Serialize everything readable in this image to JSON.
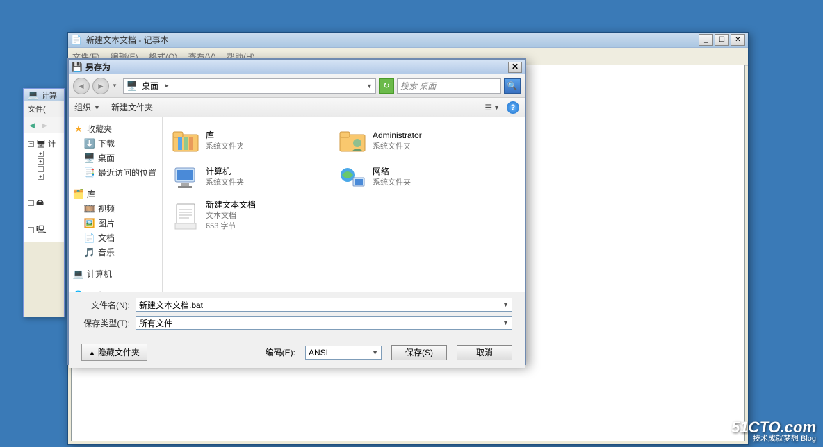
{
  "bgwin": {
    "title": "计算",
    "menu": "文件(",
    "tree": {
      "root": "计",
      "items": [
        "",
        "",
        "",
        ""
      ]
    }
  },
  "notepad": {
    "title": "新建文本文档 - 记事本",
    "menu": {
      "file": "文件(F)",
      "edit": "编辑(E)",
      "format": "格式(O)",
      "view": "查看(V)",
      "help": "帮助(H)"
    }
  },
  "saveas": {
    "title": "另存为",
    "path": "桌面",
    "search_placeholder": "搜索 桌面",
    "toolbar": {
      "organize": "组织",
      "newfolder": "新建文件夹"
    },
    "sidebar": {
      "favorites": {
        "label": "收藏夹",
        "items": [
          {
            "icon": "⬇️",
            "label": "下载"
          },
          {
            "icon": "🖥️",
            "label": "桌面"
          },
          {
            "icon": "📑",
            "label": "最近访问的位置"
          }
        ]
      },
      "libraries": {
        "label": "库",
        "items": [
          {
            "icon": "🎞️",
            "label": "视频"
          },
          {
            "icon": "🖼️",
            "label": "图片"
          },
          {
            "icon": "📄",
            "label": "文档"
          },
          {
            "icon": "🎵",
            "label": "音乐"
          }
        ]
      },
      "computer": {
        "label": "计算机"
      },
      "network": {
        "label": "网络"
      }
    },
    "content": [
      {
        "icon": "library",
        "title": "库",
        "sub": "系统文件夹"
      },
      {
        "icon": "user",
        "title": "Administrator",
        "sub": "系统文件夹"
      },
      {
        "icon": "computer",
        "title": "计算机",
        "sub": "系统文件夹"
      },
      {
        "icon": "network",
        "title": "网络",
        "sub": "系统文件夹"
      },
      {
        "icon": "txt",
        "title": "新建文本文档",
        "sub": "文本文档",
        "sub2": "653 字节"
      }
    ],
    "filename_label": "文件名(N):",
    "filename_value": "新建文本文档.bat",
    "savetype_label": "保存类型(T):",
    "savetype_value": "所有文件",
    "hidefolders": "隐藏文件夹",
    "encoding_label": "编码(E):",
    "encoding_value": "ANSI",
    "save_btn": "保存(S)",
    "cancel_btn": "取消"
  },
  "watermark": {
    "big": "51CTO.com",
    "small": "技术成就梦想   Blog"
  }
}
